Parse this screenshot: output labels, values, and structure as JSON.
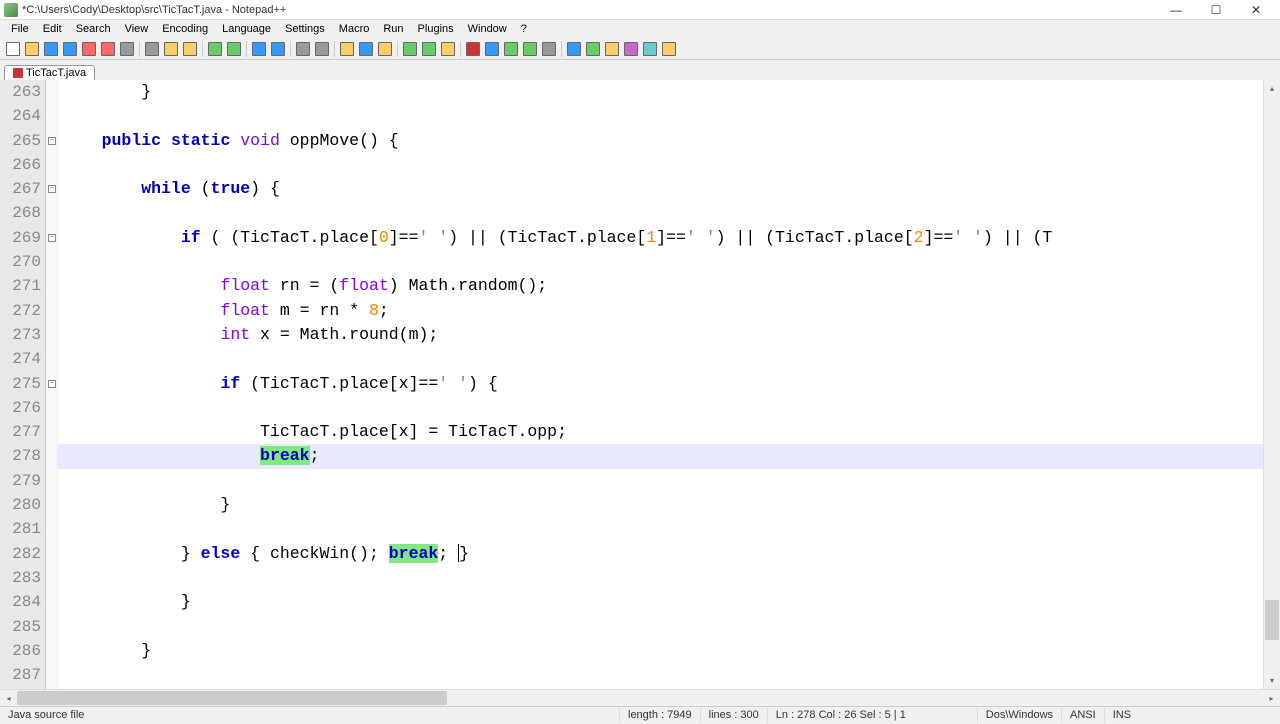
{
  "title": "*C:\\Users\\Cody\\Desktop\\src\\TicTacT.java - Notepad++",
  "menus": [
    "File",
    "Edit",
    "Search",
    "View",
    "Encoding",
    "Language",
    "Settings",
    "Macro",
    "Run",
    "Plugins",
    "Window",
    "?"
  ],
  "tab": {
    "label": "TicTacT.java"
  },
  "line_numbers": [
    263,
    264,
    265,
    266,
    267,
    268,
    269,
    270,
    271,
    272,
    273,
    274,
    275,
    276,
    277,
    278,
    279,
    280,
    281,
    282,
    283,
    284,
    285,
    286,
    287
  ],
  "code_lines": [
    {
      "raw": "        }"
    },
    {
      "raw": ""
    },
    {
      "raw": "    public static void oppMove() {"
    },
    {
      "raw": ""
    },
    {
      "raw": "        while (true) {"
    },
    {
      "raw": ""
    },
    {
      "raw": "            if ( (TicTacT.place[0]==' ') || (TicTacT.place[1]==' ') || (TicTacT.place[2]==' ') || (T"
    },
    {
      "raw": ""
    },
    {
      "raw": "                float rn = (float) Math.random();"
    },
    {
      "raw": "                float m = rn * 8;"
    },
    {
      "raw": "                int x = Math.round(m);"
    },
    {
      "raw": ""
    },
    {
      "raw": "                if (TicTacT.place[x]==' ') {"
    },
    {
      "raw": ""
    },
    {
      "raw": "                    TicTacT.place[x] = TicTacT.opp;"
    },
    {
      "raw": "                    break;",
      "hl": true
    },
    {
      "raw": ""
    },
    {
      "raw": "                }"
    },
    {
      "raw": ""
    },
    {
      "raw": "            } else { checkWin(); break; }"
    },
    {
      "raw": ""
    },
    {
      "raw": "            }"
    },
    {
      "raw": ""
    },
    {
      "raw": "        }"
    },
    {
      "raw": ""
    }
  ],
  "status": {
    "filetype": "Java source file",
    "length": "length : 7949",
    "lines": "lines : 300",
    "pos": "Ln : 278    Col : 26    Sel : 5 | 1",
    "eol": "Dos\\Windows",
    "enc": "ANSI",
    "mode": "INS"
  },
  "toolbar_icons": [
    "new",
    "open",
    "save",
    "saveall",
    "close",
    "closeall",
    "print",
    "sep",
    "cut",
    "copy",
    "paste",
    "sep",
    "undo",
    "redo",
    "sep",
    "find",
    "replace",
    "sep",
    "zoomin",
    "zoomout",
    "sep",
    "wrap",
    "allchars",
    "indent",
    "sep",
    "fold",
    "unfold",
    "folder",
    "sep",
    "rec",
    "stop",
    "play",
    "playmulti",
    "save-macro",
    "sep",
    "s1",
    "s2",
    "s3",
    "s4",
    "s5",
    "s6"
  ]
}
